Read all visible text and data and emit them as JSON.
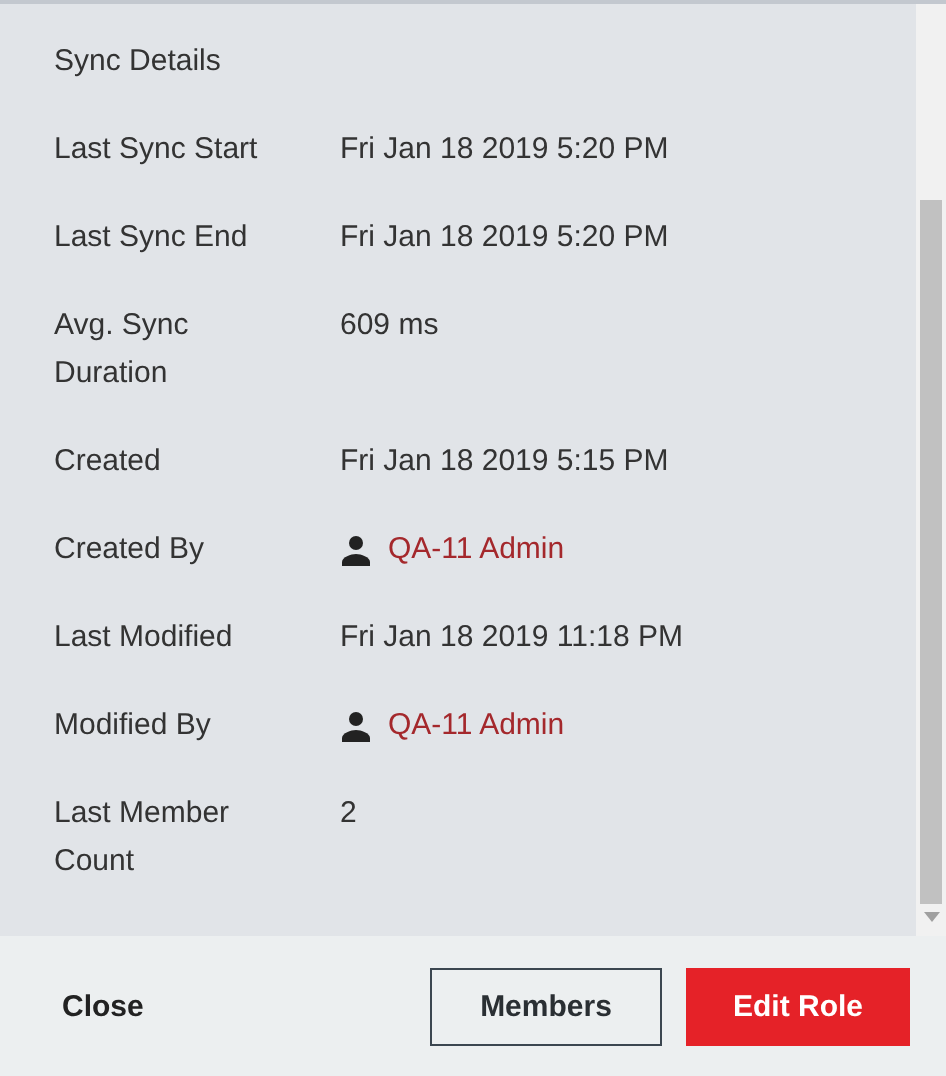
{
  "section_title": "Sync Details",
  "rows": [
    {
      "label": "Last Sync Start",
      "kind": "text",
      "value": "Fri Jan 18 2019 5:20 PM"
    },
    {
      "label": "Last Sync End",
      "kind": "text",
      "value": "Fri Jan 18 2019 5:20 PM"
    },
    {
      "label": "Avg. Sync Duration",
      "kind": "text",
      "value": "609 ms"
    },
    {
      "label": "Created",
      "kind": "text",
      "value": "Fri Jan 18 2019 5:15 PM"
    },
    {
      "label": "Created By",
      "kind": "user",
      "value": "QA-11 Admin"
    },
    {
      "label": "Last Modified",
      "kind": "text",
      "value": "Fri Jan 18 2019 11:18 PM"
    },
    {
      "label": "Modified By",
      "kind": "user",
      "value": "QA-11 Admin"
    },
    {
      "label": "Last Member Count",
      "kind": "text",
      "value": "2"
    }
  ],
  "footer": {
    "close": "Close",
    "members": "Members",
    "edit": "Edit Role"
  }
}
